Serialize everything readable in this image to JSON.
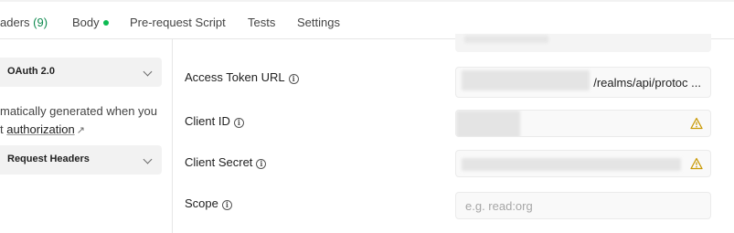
{
  "tabs": [
    {
      "label": "aders",
      "count": "(9)"
    },
    {
      "label": "Body"
    },
    {
      "label": "Pre-request Script"
    },
    {
      "label": "Tests"
    },
    {
      "label": "Settings"
    }
  ],
  "colors": {
    "body_dot": "#0cbb52",
    "count": "#0f8a4f",
    "warning": "#c99a06"
  },
  "sidebar": {
    "auth_type": "OAuth 2.0",
    "help_line1": "matically generated when you",
    "help_line2_prefix": "t ",
    "help_link": "authorization",
    "help_link_icon": "↗",
    "request_headers": "Request Headers"
  },
  "fields": {
    "access_token_url": {
      "label": "Access Token URL",
      "value": "/realms/api/protoc ..."
    },
    "client_id": {
      "label": "Client ID",
      "warning_icon": "warning-icon"
    },
    "client_secret": {
      "label": "Client Secret",
      "warning_icon": "warning-icon"
    },
    "scope": {
      "label": "Scope",
      "placeholder": "e.g. read:org"
    }
  }
}
